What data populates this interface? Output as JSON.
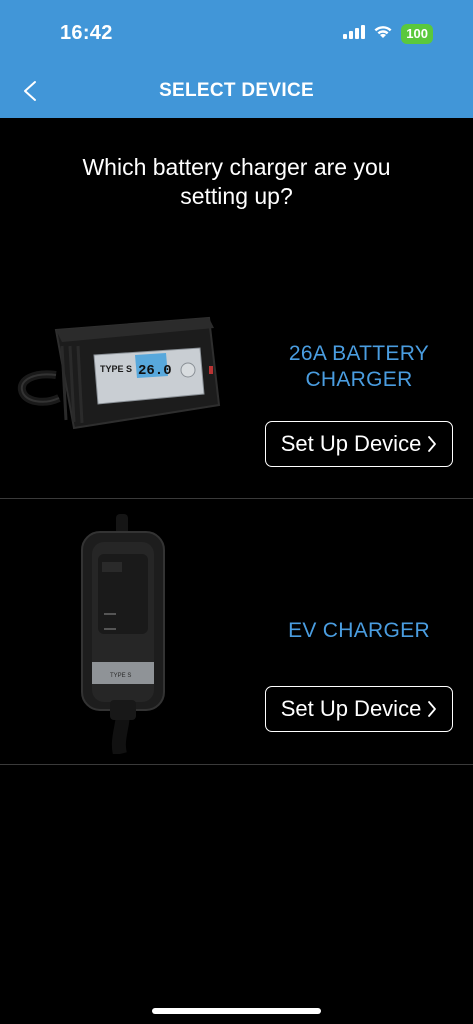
{
  "status_bar": {
    "time": "16:42",
    "battery": "100"
  },
  "header": {
    "title": "SELECT DEVICE"
  },
  "question": "Which battery charger are you setting up?",
  "devices": [
    {
      "name": "26A BATTERY CHARGER",
      "button_label": "Set Up Device",
      "image_icon": "battery-charger-image",
      "display_reading": "26.0",
      "brand": "TYPE S"
    },
    {
      "name": "EV CHARGER",
      "button_label": "Set Up Device",
      "image_icon": "ev-charger-image",
      "brand": "TYPE S"
    }
  ],
  "colors": {
    "header_bg": "#4196d8",
    "accent": "#4a9de0",
    "background": "#000000"
  }
}
